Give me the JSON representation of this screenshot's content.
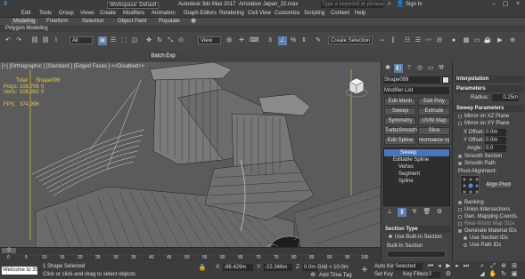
{
  "app": {
    "workspace": "Workspace: Default",
    "title": "Autodesk 3ds Max 2017",
    "file": "Artstation Japan_22.max",
    "search_placeholder": "Type a keyword or phrase",
    "sign_in": "Sign In"
  },
  "menu": [
    "Edit",
    "Tools",
    "Group",
    "Views",
    "Create",
    "Modifiers",
    "Animation",
    "Graph Editors",
    "Rendering",
    "Civil View",
    "Customize",
    "Scripting",
    "Content",
    "Help"
  ],
  "ribbon": {
    "tabs": [
      "Modeling",
      "Freeform",
      "Selection",
      "Object Paint",
      "Populate"
    ],
    "sub": "Polygon Modeling"
  },
  "toolbar": {
    "filter": "All",
    "view": "View",
    "create_selection": "Create Selection Se",
    "batch": "Batch Exp"
  },
  "viewport": {
    "label": "[+] [Orthographic ] [Standard ] [Edged Faces ]  <<Disabled>>",
    "stats_title": "Total",
    "stats_object": "Shape099",
    "polys_label": "Polys:",
    "polys_total": "108,706",
    "polys_obj": "0",
    "verts_label": "Verts:",
    "verts_total": "106,392",
    "verts_obj": "0",
    "fps_label": "FPS:",
    "fps_value": "374.996"
  },
  "command_panel": {
    "object_name": "Shape099",
    "modifier_list": "Modifier List",
    "buttons": [
      "Edit Mesh",
      "Edit Poly",
      "Sweep",
      "Extrude",
      "Symmetry",
      "UVW Map",
      "TurboSmooth",
      "Slice",
      "Edit Spline",
      "Normalize Spl..."
    ],
    "stack": [
      "Sweep",
      "Editable Spline",
      "Vertex",
      "Segment",
      "Spline"
    ],
    "section_type": "Section Type",
    "use_builtin": "Use Built-In Section",
    "builtin": "Built-In Section"
  },
  "right_panel": {
    "interpolation": "Interpolation",
    "parameters": "Parameters",
    "radius_label": "Radius:",
    "radius": "0.25m",
    "sweep_params": "Sweep Parameters",
    "mirror_xz": "Mirror on XZ Plane",
    "mirror_xy": "Mirror on XY Plane",
    "xoffset_label": "X Offset:",
    "xoffset": "0.0m",
    "yoffset_label": "Y Offset:",
    "yoffset": "0.0m",
    "angle_label": "Angle:",
    "angle": "0.0",
    "smooth_section": "Smooth Section",
    "smooth_path": "Smooth Path",
    "pivot_alignment": "Pivot Alignment:",
    "align_pivot": "Align Pivot",
    "banking": "Banking",
    "union": "Union Intersections",
    "gen_mapping": "Gen. Mapping Coords.",
    "real_world": "Real-World Map Size",
    "gen_material": "Generate Material IDs",
    "use_section_ids": "Use Section IDs",
    "use_path_ids": "Use Path IDs"
  },
  "status": {
    "welcome": "Welcome to 3S",
    "selected": "1 Shape Selected",
    "hint": "Click or click-and-drag to select objects",
    "x_label": "X:",
    "x": "-86.429m",
    "y_label": "Y:",
    "y": "-22.346m",
    "z_label": "Z:",
    "z": "0.0m",
    "grid": "Grid = 10.0m",
    "add_time_tag": "Add Time Tag",
    "auto_key": "Auto Key",
    "selected_label": "Selected",
    "set_key": "Set Key",
    "key_filters": "Key Filters...",
    "frame": "0",
    "timeline_end": "100",
    "timeline_ticks": [
      "0",
      "5",
      "10",
      "15",
      "20",
      "25",
      "30",
      "35",
      "40",
      "45",
      "50",
      "55",
      "60",
      "65",
      "70",
      "75",
      "80",
      "85",
      "90",
      "95",
      "100"
    ]
  }
}
